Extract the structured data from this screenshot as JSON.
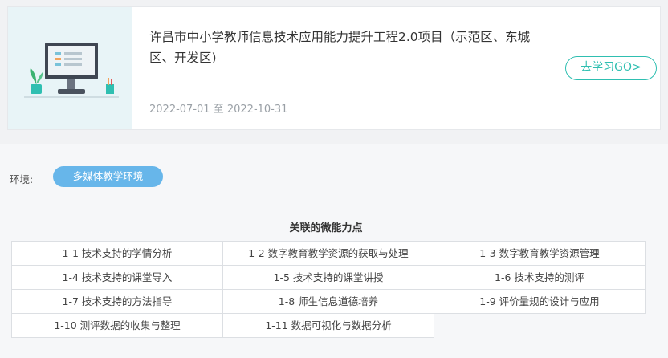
{
  "course": {
    "title": "许昌市中小学教师信息技术应用能力提升工程2.0项目（示范区、东城区、开发区)",
    "date_start": "2022-07-01",
    "date_separator": "至",
    "date_end": "2022-10-31",
    "go_button": "去学习GO>",
    "thumbnail_icon": "desktop-computer-illustration-icon"
  },
  "environment": {
    "label": "环境:",
    "value": "多媒体教学环境"
  },
  "abilities": {
    "title": "关联的微能力点",
    "items": [
      "1-1 技术支持的学情分析",
      "1-2 数字教育教学资源的获取与处理",
      "1-3 数字教育教学资源管理",
      "1-4 技术支持的课堂导入",
      "1-5 技术支持的课堂讲授",
      "1-6 技术支持的测评",
      "1-7 技术支持的方法指导",
      "1-8 师生信息道德培养",
      "1-9 评价量规的设计与应用",
      "1-10 测评数据的收集与整理",
      "1-11 数据可视化与数据分析"
    ]
  },
  "colors": {
    "accent_teal": "#2fbfb1",
    "pill_blue": "#67b6ea"
  }
}
